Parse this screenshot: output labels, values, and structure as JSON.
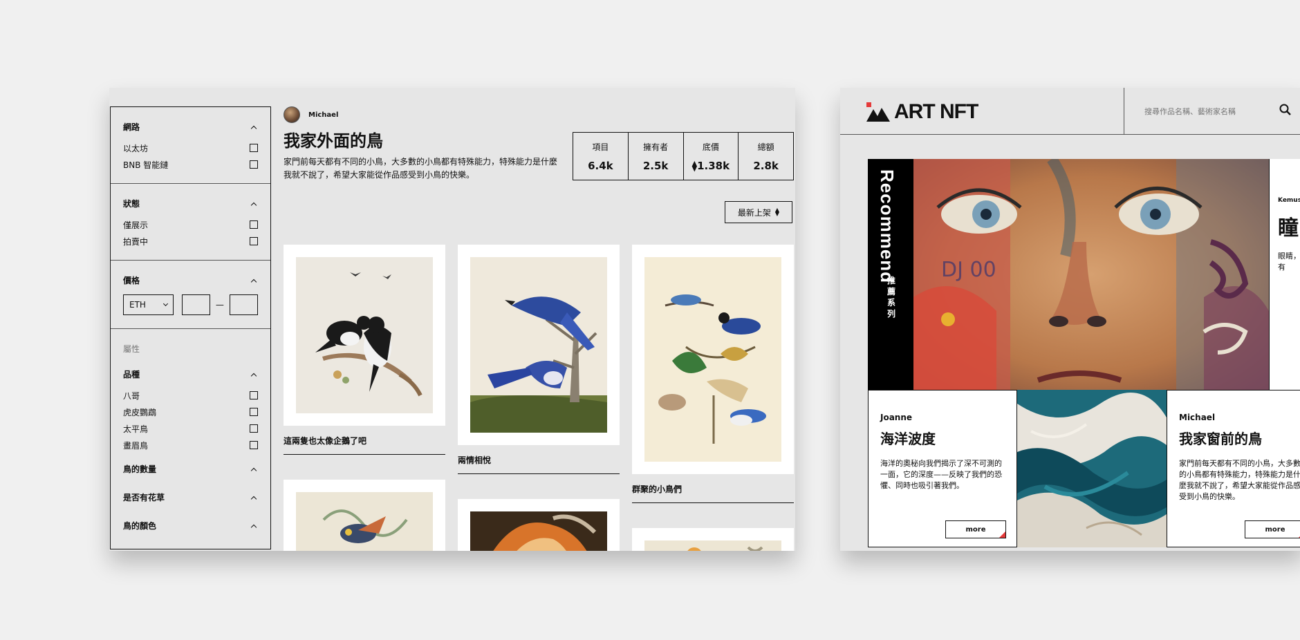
{
  "left": {
    "filters": {
      "network": {
        "title": "網路",
        "options": [
          "以太坊",
          "BNB 智能鏈"
        ]
      },
      "status": {
        "title": "狀態",
        "options": [
          "僅展示",
          "拍賣中"
        ]
      },
      "price": {
        "title": "價格",
        "currency": "ETH",
        "dash": "—"
      },
      "attributes": {
        "label": "屬性",
        "breed": {
          "title": "品種",
          "options": [
            "八哥",
            "虎皮鸚鵡",
            "太平鳥",
            "畫眉鳥"
          ]
        },
        "count": "鳥的數量",
        "flowers": "是否有花草",
        "color": "鳥的顏色"
      }
    },
    "collection": {
      "owner": "Michael",
      "title": "我家外面的鳥",
      "description": "家門前每天都有不同的小鳥，大多數的小鳥都有特殊能力，特殊能力是什麼我就不說了，希望大家能從作品感受到小鳥的快樂。",
      "stats": [
        {
          "label": "項目",
          "value": "6.4k"
        },
        {
          "label": "擁有者",
          "value": "2.5k"
        },
        {
          "label": "底價",
          "value": "⧫1.38k"
        },
        {
          "label": "總額",
          "value": "2.8k"
        }
      ],
      "sort": "最新上架"
    },
    "cards": [
      {
        "title": "這兩隻也太像企鵝了吧"
      },
      {
        "title": "兩情相悅"
      },
      {
        "title": "群聚的小鳥們"
      }
    ]
  },
  "right": {
    "brand": "ART NFT",
    "search_placeholder": "搜尋作品名稱、藝術家名稱",
    "recommend": {
      "en": "Recommend",
      "zh": "推薦系列"
    },
    "hero_side": {
      "artist": "Kemus",
      "title": "瞳",
      "desc": "眼睛，睛裡有"
    },
    "cards": [
      {
        "artist": "Joanne",
        "title": "海洋波度",
        "desc": "海洋的奧秘向我們揭示了深不可測的一面，它的深度——反映了我們的恐懼、同時也吸引著我們。",
        "more": "more"
      },
      {
        "artist": "Michael",
        "title": "我家窗前的鳥",
        "desc": "家門前每天都有不同的小鳥，大多數的小鳥都有特殊能力，特殊能力是什麼我就不說了，希望大家能從作品感受到小鳥的快樂。",
        "more": "more"
      }
    ]
  },
  "colors": {
    "background": "#f0f0f0",
    "panel": "#e6e6e6",
    "ink": "#111111",
    "accent": "#e53a3a"
  }
}
